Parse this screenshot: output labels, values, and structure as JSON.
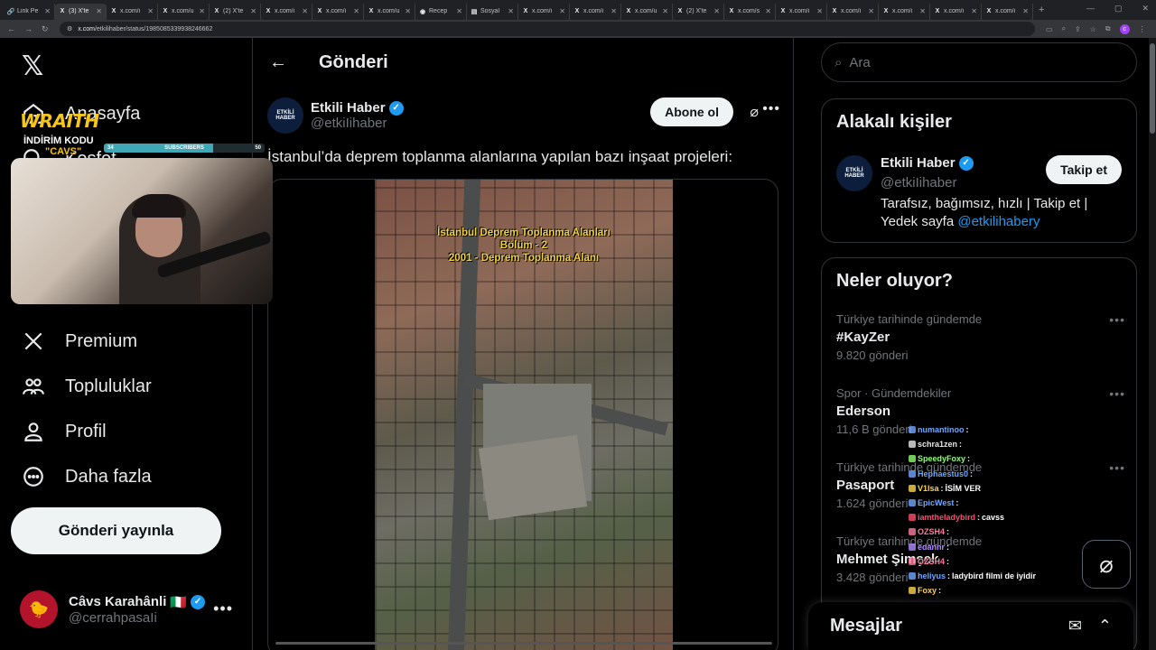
{
  "browser": {
    "tabs": [
      {
        "icon": "link-icon",
        "label": "Link Pe",
        "active": false
      },
      {
        "icon": "x-logo-icon",
        "label": "(3) X'te",
        "active": true
      },
      {
        "icon": "x-logo-icon",
        "label": "x.com/i",
        "active": false
      },
      {
        "icon": "x-logo-icon",
        "label": "x.com/u",
        "active": false
      },
      {
        "icon": "x-logo-icon",
        "label": "(2) X'te",
        "active": false
      },
      {
        "icon": "x-logo-icon",
        "label": "x.com/i",
        "active": false
      },
      {
        "icon": "x-logo-icon",
        "label": "x.com/i",
        "active": false
      },
      {
        "icon": "x-logo-icon",
        "label": "x.com/u",
        "active": false
      },
      {
        "icon": "globe-icon",
        "label": "Recep",
        "active": false
      },
      {
        "icon": "doc-icon",
        "label": "Sosyal",
        "active": false
      },
      {
        "icon": "x-logo-icon",
        "label": "x.com/i",
        "active": false
      },
      {
        "icon": "x-logo-icon",
        "label": "x.com/i",
        "active": false
      },
      {
        "icon": "x-logo-icon",
        "label": "x.com/u",
        "active": false
      },
      {
        "icon": "x-logo-icon",
        "label": "(2) X'te",
        "active": false
      },
      {
        "icon": "x-logo-icon",
        "label": "x.com/s",
        "active": false
      },
      {
        "icon": "x-logo-icon",
        "label": "x.com/i",
        "active": false
      },
      {
        "icon": "x-logo-icon",
        "label": "x.com/i",
        "active": false
      },
      {
        "icon": "x-logo-icon",
        "label": "x.com/i",
        "active": false
      },
      {
        "icon": "x-logo-icon",
        "label": "x.com/i",
        "active": false
      },
      {
        "icon": "x-logo-icon",
        "label": "x.com/i",
        "active": false
      }
    ],
    "url_host": "x.com",
    "url_path": "/etkilihaber/status/1985085339938246662"
  },
  "nav": {
    "items": [
      {
        "icon": "home-icon",
        "label": "Anasayfa"
      },
      {
        "icon": "search-icon",
        "label": "Keşfet"
      },
      {
        "icon": "x-premium-icon",
        "label": "Premium"
      },
      {
        "icon": "communities-icon",
        "label": "Topluluklar"
      },
      {
        "icon": "profile-icon",
        "label": "Profil"
      },
      {
        "icon": "more-circle-icon",
        "label": "Daha fazla"
      }
    ],
    "post_button": "Gönderi yayınla",
    "account": {
      "name": "Câvs Karahânli",
      "flag": "🇮🇹",
      "handle": "@cerrahpasaIi"
    }
  },
  "overlay": {
    "brand": "WRAITH",
    "promo_line1": "İNDİRİM KODU",
    "promo_line2": "\"CAVS\"",
    "sub_goal": {
      "current": "34",
      "label": "SUBSCRIBERS",
      "target": "50",
      "progress": 0.68
    }
  },
  "main": {
    "title": "Gönderi",
    "tweet": {
      "author": "Etkili Haber",
      "handle": "@etkiIihaber",
      "avatar_text": "ETKİLİ HABER",
      "subscribe": "Abone ol",
      "text": "İstanbul’da deprem toplanma alanlarına yapılan bazı inşaat projeleri:",
      "video_caption": [
        "İstanbul Deprem Toplanma Alanları",
        "Bölüm - 2",
        "2001 - Deprem Toplanma Alanı"
      ]
    }
  },
  "right": {
    "search_placeholder": "Ara",
    "related": {
      "title": "Alakalı kişiler",
      "name": "Etkili Haber",
      "handle": "@etkiIihaber",
      "bio": "Tarafsız, bağımsız, hızlı | Takip et | Yedek sayfa ",
      "bio_link": "@etkilihabery",
      "follow": "Takip et",
      "avatar_text": "ETKİLİ HABER"
    },
    "trends_title": "Neler oluyor?",
    "trends": [
      {
        "meta": "Türkiye tarihinde gündemde",
        "name": "#KayZer",
        "count": "9.820 gönderi"
      },
      {
        "meta": "Spor · Gündemdekiler",
        "name": "Ederson",
        "count": "11,6 B gönderi"
      },
      {
        "meta": "Türkiye tarihinde gündemde",
        "name": "Pasaport",
        "count": "1.624 gönderi"
      },
      {
        "meta": "Türkiye tarihinde gündemde",
        "name": "Mehmet Şimşek",
        "count": "3.428 gönderi"
      }
    ],
    "messages": "Mesajlar"
  },
  "chat": [
    {
      "user": "numantinoo",
      "color": "#6fa8ff",
      "msg": ""
    },
    {
      "user": "schra1zen",
      "color": "#e6e6e6",
      "msg": ""
    },
    {
      "user": "SpeedyFoxy",
      "color": "#8cff6e",
      "msg": ""
    },
    {
      "user": "Hephaestus0",
      "color": "#6fa8ff",
      "msg": ""
    },
    {
      "user": "V1lsa",
      "color": "#ffd24d",
      "msg": "İSİM VER"
    },
    {
      "user": "EpicWest",
      "color": "#6fa8ff",
      "msg": ""
    },
    {
      "user": "iamtheladybird",
      "color": "#ff4d6d",
      "msg": "cavss"
    },
    {
      "user": "OZSH4",
      "color": "#ff7aa2",
      "msg": ""
    },
    {
      "user": "edannr",
      "color": "#b48cff",
      "msg": ""
    },
    {
      "user": "OZSH4",
      "color": "#ff7aa2",
      "msg": ""
    },
    {
      "user": "heliyus",
      "color": "#6fa8ff",
      "msg": "ladybird filmi de iyidir"
    },
    {
      "user": "Foxy",
      "color": "#ffd24d",
      "msg": ""
    }
  ]
}
